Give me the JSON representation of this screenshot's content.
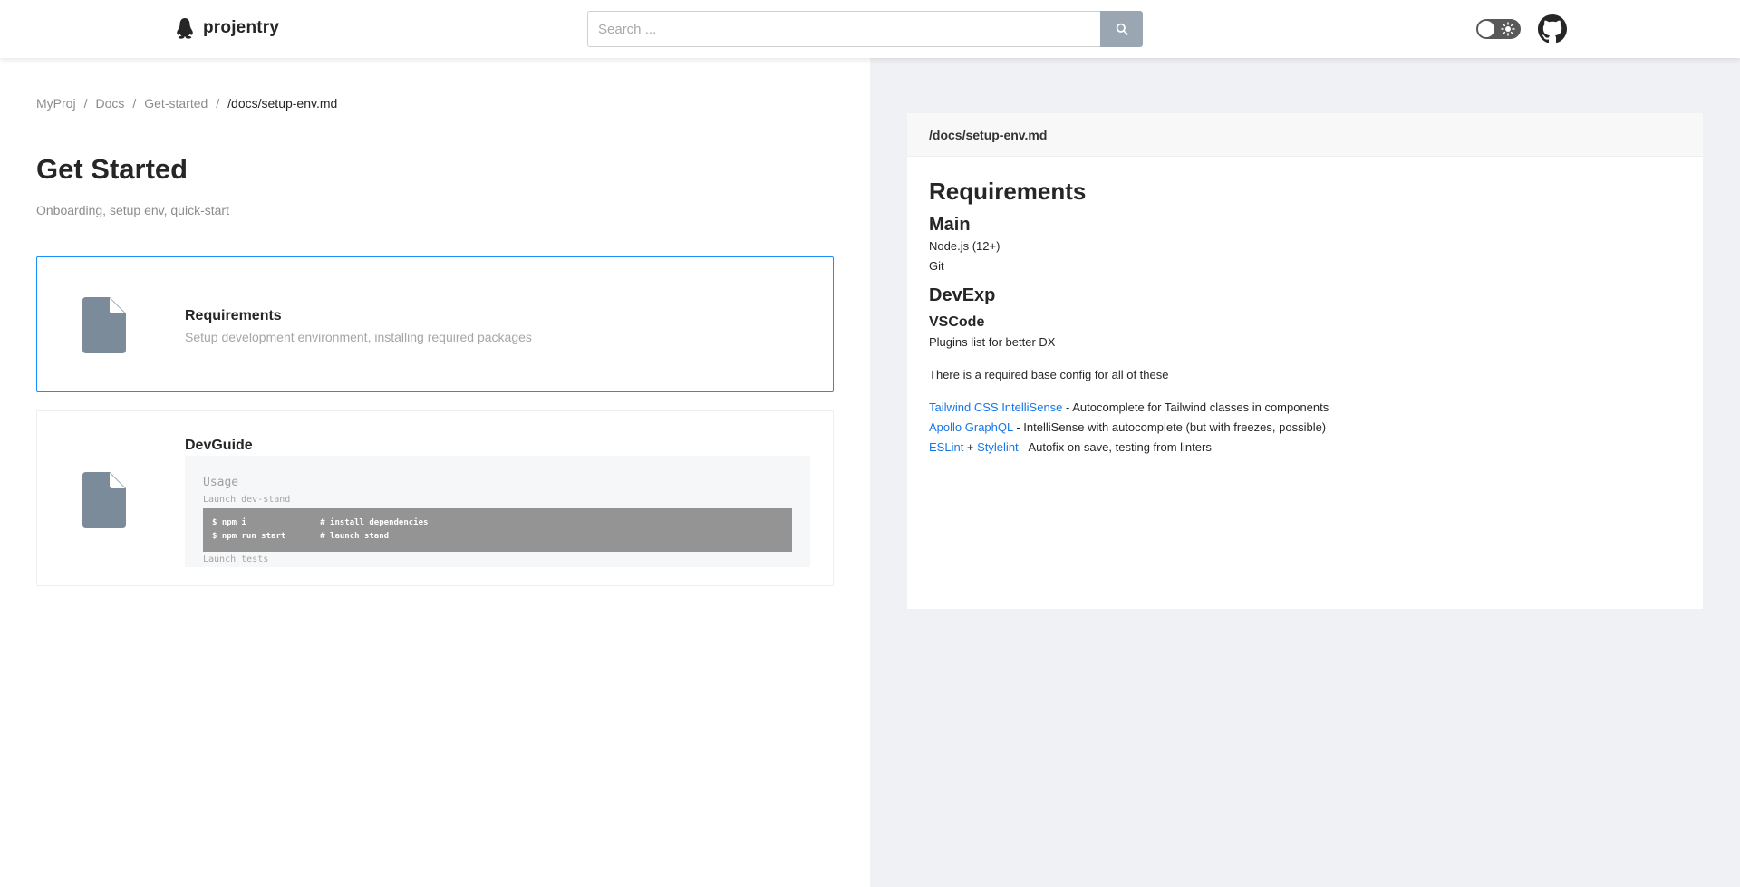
{
  "header": {
    "logo_text": "projentry",
    "search": {
      "placeholder": "Search ...",
      "value": ""
    },
    "theme_toggle": {
      "state": "light"
    }
  },
  "breadcrumb": {
    "items": [
      "MyProj",
      "Docs",
      "Get-started"
    ],
    "current": "/docs/setup-env.md",
    "separator": "/"
  },
  "page": {
    "title": "Get Started",
    "subtitle": "Onboarding, setup env, quick-start"
  },
  "cards": [
    {
      "title": "Requirements",
      "description": "Setup development environment, installing required packages"
    },
    {
      "title": "DevGuide",
      "preview": {
        "heading": "Usage",
        "line1": "Launch dev-stand",
        "code": "$ npm i               # install dependencies\n$ npm run start       # launch stand",
        "line2": "Launch tests"
      }
    }
  ],
  "doc": {
    "path": "/docs/setup-env.md",
    "h1": "Requirements",
    "main_heading": "Main",
    "main_items": [
      "Node.js (12+)",
      "Git"
    ],
    "devexp_heading": "DevExp",
    "vscode_heading": "VSCode",
    "vscode_desc": "Plugins list for better DX",
    "base_config_note": "There is a required base config for all of these",
    "plugins": [
      {
        "link": "Tailwind CSS IntelliSense",
        "text": " - Autocomplete for Tailwind classes in components"
      },
      {
        "link": "Apollo GraphQL",
        "text": " - IntelliSense with autocomplete (but with freezes, possible)"
      },
      {
        "link": "ESLint",
        "join": " + ",
        "link2": "Stylelint",
        "text": " - Autofix on save, testing from linters"
      }
    ]
  },
  "colors": {
    "accent": "#1890ff",
    "link": "#1677e8",
    "doc_icon": "#7b8b9a",
    "right_bg": "#f0f1f4",
    "search_button": "#9aa6b2"
  },
  "icons": [
    "penguin-logo-icon",
    "search-icon",
    "sun-icon",
    "github-icon",
    "file-icon"
  ]
}
